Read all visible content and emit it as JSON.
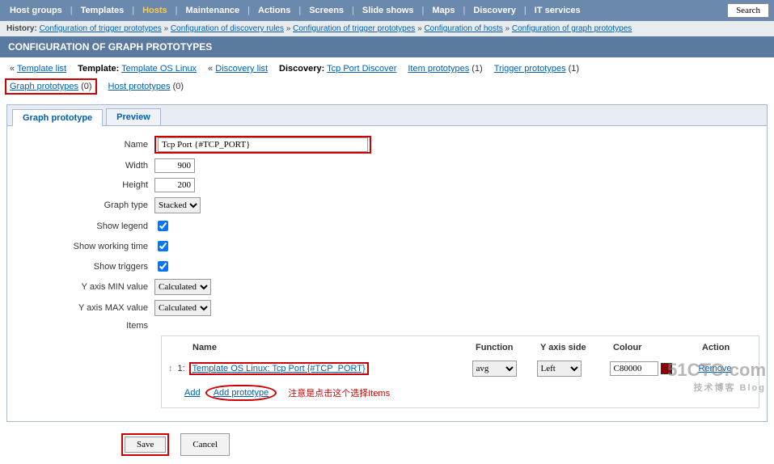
{
  "nav": {
    "items": [
      "Host groups",
      "Templates",
      "Hosts",
      "Maintenance",
      "Actions",
      "Screens",
      "Slide shows",
      "Maps",
      "Discovery",
      "IT services"
    ],
    "active_index": 2,
    "search_label": "Search"
  },
  "history": {
    "label": "History:",
    "items": [
      "Configuration of trigger prototypes",
      "Configuration of discovery rules",
      "Configuration of trigger prototypes",
      "Configuration of hosts",
      "Configuration of graph prototypes"
    ]
  },
  "page_title": "CONFIGURATION OF GRAPH PROTOTYPES",
  "subnav": {
    "template_list": "Template list",
    "template_label": "Template:",
    "template_link": "Template OS Linux",
    "discovery_list": "Discovery list",
    "discovery_label": "Discovery:",
    "discovery_link": "Tcp Port Discover",
    "item_proto": "Item prototypes",
    "item_proto_count": "(1)",
    "trigger_proto": "Trigger prototypes",
    "trigger_proto_count": "(1)",
    "graph_proto": "Graph prototypes",
    "graph_proto_count": "(0)",
    "host_proto": "Host prototypes",
    "host_proto_count": "(0)"
  },
  "tabs": {
    "t1": "Graph prototype",
    "t2": "Preview"
  },
  "form": {
    "name_label": "Name",
    "name_value": "Tcp Port {#TCP_PORT}",
    "width_label": "Width",
    "width_value": "900",
    "height_label": "Height",
    "height_value": "200",
    "graph_type_label": "Graph type",
    "graph_type_value": "Stacked",
    "show_legend_label": "Show legend",
    "show_wt_label": "Show working time",
    "show_trig_label": "Show triggers",
    "ymin_label": "Y axis MIN value",
    "ymin_value": "Calculated",
    "ymax_label": "Y axis MAX value",
    "ymax_value": "Calculated",
    "items_label": "Items"
  },
  "items_table": {
    "hdr_name": "Name",
    "hdr_func": "Function",
    "hdr_side": "Y axis side",
    "hdr_colour": "Colour",
    "hdr_action": "Action",
    "row_num": "1:",
    "row_name": "Template OS Linux: Tcp Port {#TCP_PORT}",
    "row_func": "avg",
    "row_side": "Left",
    "row_colour": "C80000",
    "row_remove": "Remove",
    "add_label": "Add",
    "add_prototype": "Add prototype",
    "note": "注意是点击这个选择Items"
  },
  "buttons": {
    "save": "Save",
    "cancel": "Cancel"
  },
  "watermark": {
    "line1": "51CTO.com",
    "line2": "技术博客   Blog"
  }
}
